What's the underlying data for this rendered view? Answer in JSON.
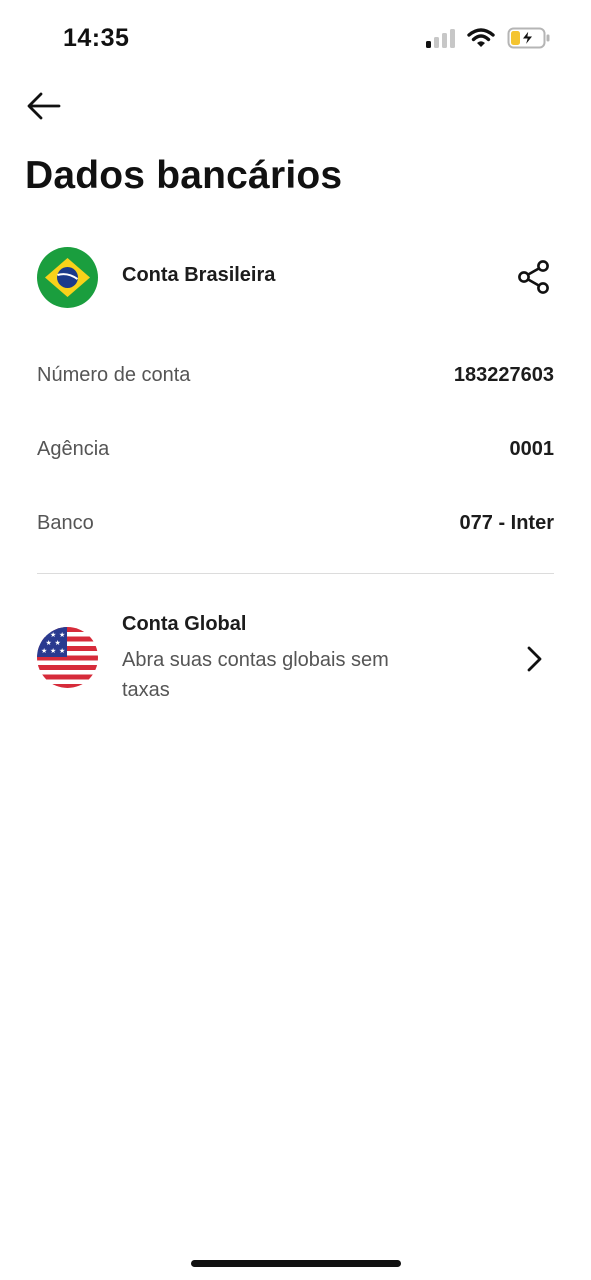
{
  "status_bar": {
    "time": "14:35"
  },
  "page": {
    "title": "Dados bancários"
  },
  "brazil_account": {
    "name": "Conta Brasileira",
    "rows": [
      {
        "label": "Número de conta",
        "value": "183227603"
      },
      {
        "label": "Agência",
        "value": "0001"
      },
      {
        "label": "Banco",
        "value": "077 - Inter"
      }
    ]
  },
  "global_account": {
    "title": "Conta Global",
    "subtitle": "Abra suas contas globais sem taxas"
  },
  "icons": {
    "back": "arrow-left-icon",
    "share": "share-icon",
    "chevron": "chevron-right-icon"
  }
}
